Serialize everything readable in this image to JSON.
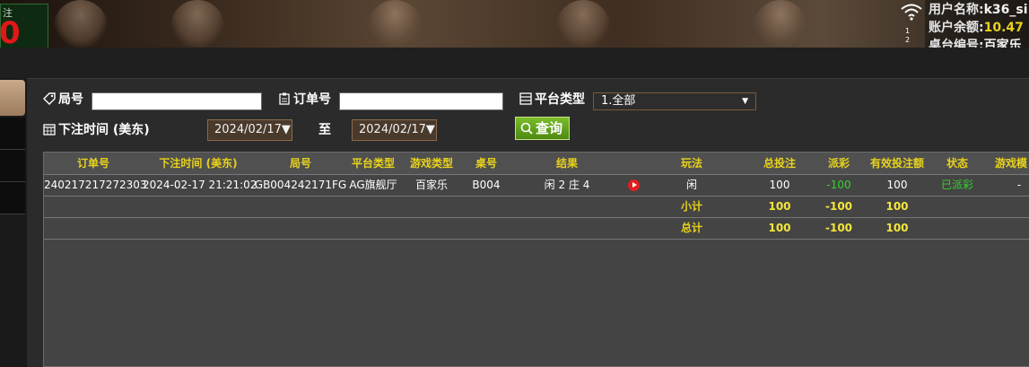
{
  "top": {
    "bet_label": "注",
    "bet_value": "0",
    "user": {
      "name_label": "用户名称:",
      "name_value": "k36_si"
    },
    "balance": {
      "label": "账户余额:",
      "value": "10.47"
    },
    "table": {
      "label": "桌台编号:",
      "value": "百家乐"
    },
    "signal_digits": [
      "1",
      "2"
    ]
  },
  "filters": {
    "round_label": "局号",
    "round_value": "",
    "order_label": "订单号",
    "order_value": "",
    "platform_label": "平台类型",
    "platform_selected": "1.全部",
    "bet_time_label": "下注时间 (美东)",
    "date_from": "2024/02/17▼",
    "to_label": "至",
    "date_to": "2024/02/17▼",
    "search_label": "查询"
  },
  "table": {
    "columns": [
      "订单号",
      "下注时间 (美东)",
      "局号",
      "平台类型",
      "游戏类型",
      "桌号",
      "结果",
      "玩法",
      "总投注",
      "派彩",
      "有效投注额",
      "状态",
      "游戏模"
    ],
    "row": {
      "order_no": "240217217272303",
      "bet_time": "2024-02-17 21:21:02",
      "round_no": "GB004242171FG",
      "platform": "AG旗舰厅",
      "game_type": "百家乐",
      "table_no": "B004",
      "result": "闲 2 庄 4",
      "play": "闲",
      "total_bet": "100",
      "payout": "-100",
      "valid_bet": "100",
      "status": "已派彩",
      "game_mode": "-"
    },
    "subtotal": {
      "label": "小计",
      "total_bet": "100",
      "payout": "-100",
      "valid_bet": "100"
    },
    "grandtotal": {
      "label": "总计",
      "total_bet": "100",
      "payout": "-100",
      "valid_bet": "100"
    }
  },
  "colors": {
    "header_text": "#e8d21c",
    "payout_green": "#34d32b",
    "search_btn": "#5e9c1a"
  }
}
